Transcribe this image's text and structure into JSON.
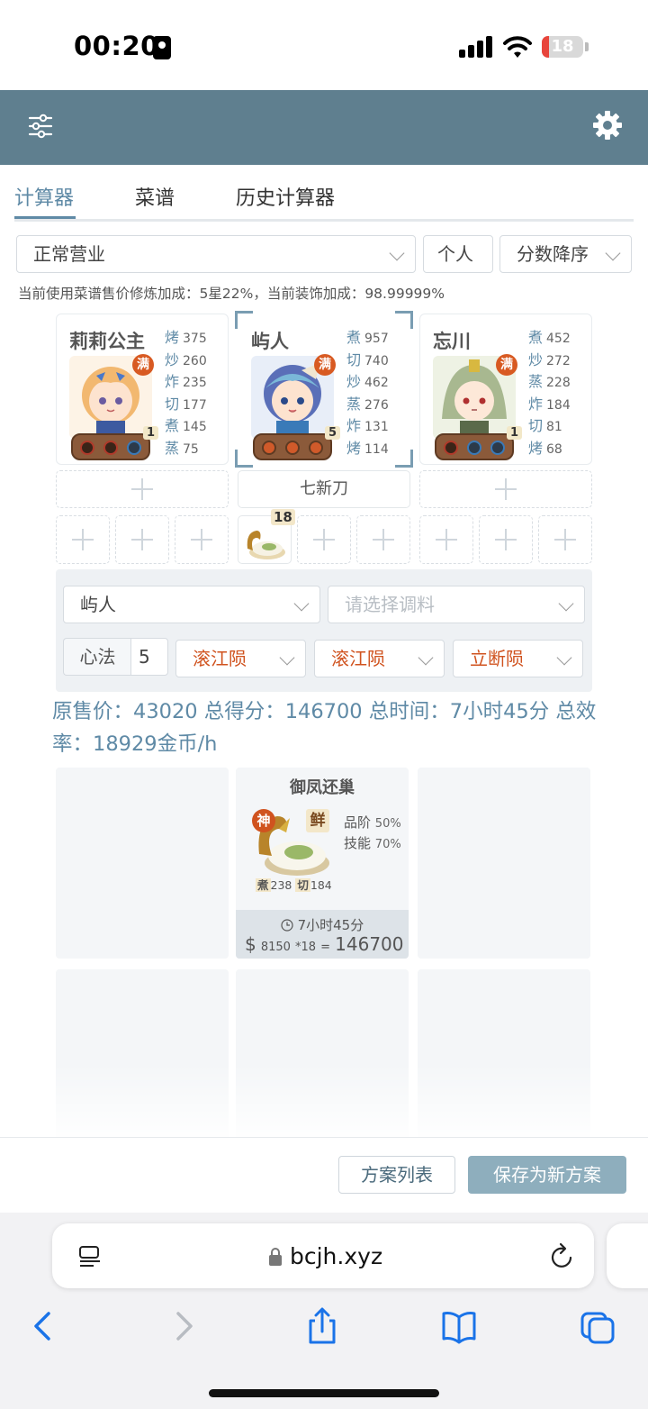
{
  "status_bar": {
    "time": "00:20",
    "battery": "18",
    "battery_level": 0.18
  },
  "tabs": [
    {
      "label": "计算器",
      "active": true
    },
    {
      "label": "菜谱",
      "active": false
    },
    {
      "label": "历史计算器",
      "active": false
    }
  ],
  "filters": {
    "mode": "正常营业",
    "scope": "个人",
    "sort": "分数降序"
  },
  "info_line": "当前使用菜谱售价修炼加成：5星22%，当前装饰加成：98.99999%",
  "chefs": [
    {
      "name": "莉莉公主",
      "full_badge": "满",
      "level": "1",
      "skills": [
        {
          "k": "烤",
          "v": "375"
        },
        {
          "k": "炒",
          "v": "260"
        },
        {
          "k": "炸",
          "v": "235"
        },
        {
          "k": "切",
          "v": "177"
        },
        {
          "k": "煮",
          "v": "145"
        },
        {
          "k": "蒸",
          "v": "75"
        }
      ],
      "equip_slot": "+"
    },
    {
      "name": "屿人",
      "full_badge": "满",
      "level": "5",
      "skills": [
        {
          "k": "煮",
          "v": "957"
        },
        {
          "k": "切",
          "v": "740"
        },
        {
          "k": "炒",
          "v": "462"
        },
        {
          "k": "蒸",
          "v": "276"
        },
        {
          "k": "炸",
          "v": "131"
        },
        {
          "k": "烤",
          "v": "114"
        }
      ],
      "equip_slot": "七新刀",
      "dish_count": "18"
    },
    {
      "name": "忘川",
      "full_badge": "满",
      "level": "1",
      "skills": [
        {
          "k": "煮",
          "v": "452"
        },
        {
          "k": "炒",
          "v": "272"
        },
        {
          "k": "蒸",
          "v": "228"
        },
        {
          "k": "炸",
          "v": "184"
        },
        {
          "k": "切",
          "v": "81"
        },
        {
          "k": "烤",
          "v": "68"
        }
      ],
      "equip_slot": "+"
    }
  ],
  "config": {
    "chef_select": "屿人",
    "seasoning_placeholder": "请选择调料",
    "xinfa_label": "心法",
    "xinfa_value": "5",
    "jades": [
      "滚江陨",
      "滚江陨",
      "立断陨"
    ]
  },
  "summary": "原售价：43020 总得分：146700 总时间：7小时45分 总效率：18929金币/h",
  "dish": {
    "name": "御凤还巢",
    "god_badge": "神",
    "fresh_badge": "鲜",
    "grade_label": "品阶",
    "grade_pct": "50%",
    "skill_label": "技能",
    "skill_pct": "70%",
    "req1_k": "煮",
    "req1_v": "238",
    "req2_k": "切",
    "req2_v": "184",
    "time": "7小时45分",
    "dollar": "$",
    "price": "8150",
    "mult": "*18",
    "eq": "=",
    "total": "146700"
  },
  "actions": {
    "list": "方案列表",
    "save": "保存为新方案"
  },
  "browser": {
    "url": "bcjh.xyz"
  },
  "colors": {
    "header": "#5f7f8f",
    "accent": "#5f8aa6",
    "red": "#d0531f"
  }
}
